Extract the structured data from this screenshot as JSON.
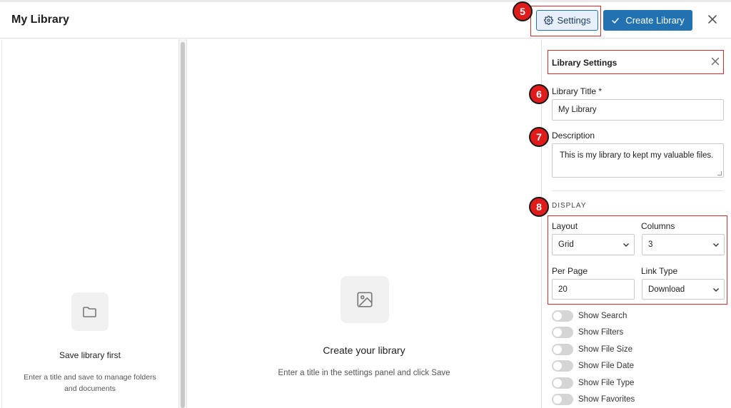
{
  "header": {
    "title": "My Library",
    "settings_label": "Settings",
    "create_label": "Create Library"
  },
  "badges": {
    "b5": "5",
    "b6": "6",
    "b7": "7",
    "b8": "8"
  },
  "left_panel": {
    "title": "Save library first",
    "description": "Enter a title and save to manage folders and documents"
  },
  "center": {
    "title": "Create your library",
    "description": "Enter a title in the settings panel and click Save"
  },
  "settings_panel": {
    "title": "Library Settings",
    "library_title_label": "Library Title *",
    "library_title_value": "My Library",
    "description_label": "Description",
    "description_value": "This is my library to kept my valuable files.",
    "display_label": "DISPLAY",
    "layout_label": "Layout",
    "layout_value": "Grid",
    "columns_label": "Columns",
    "columns_value": "3",
    "per_page_label": "Per Page",
    "per_page_value": "20",
    "link_type_label": "Link Type",
    "link_type_value": "Download",
    "toggles": [
      {
        "label": "Show Search",
        "on": false
      },
      {
        "label": "Show Filters",
        "on": false
      },
      {
        "label": "Show File Size",
        "on": false
      },
      {
        "label": "Show File Date",
        "on": false
      },
      {
        "label": "Show File Type",
        "on": false
      },
      {
        "label": "Show Favorites",
        "on": false
      }
    ]
  },
  "colors": {
    "primary": "#2271b1",
    "annotation_red": "#e01b1b"
  }
}
